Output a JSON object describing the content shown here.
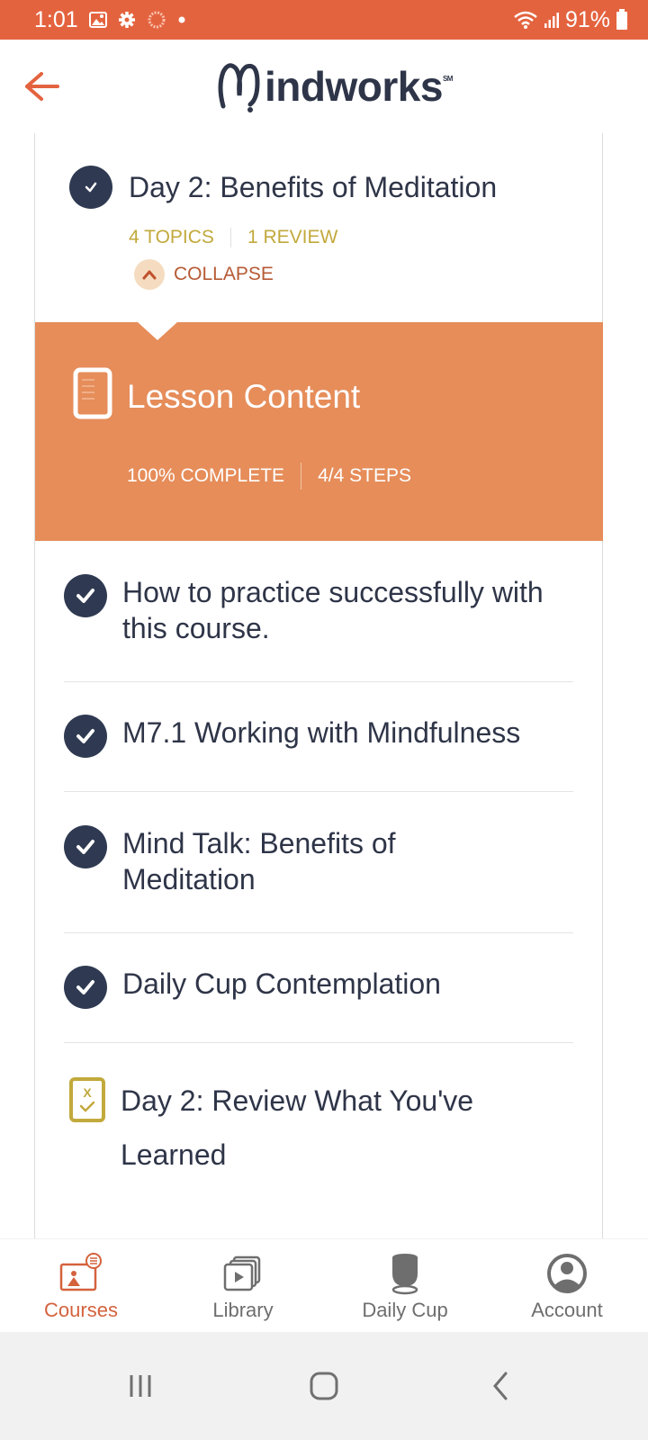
{
  "status_bar": {
    "time": "1:01",
    "battery": "91%",
    "icons": [
      "image-icon",
      "gear-icon",
      "sync-icon",
      "dot-icon",
      "wifi-icon",
      "signal-icon",
      "battery-icon"
    ]
  },
  "app_bar": {
    "back_icon": "arrow-left-icon",
    "logo_text": "indworks",
    "logo_mark": "M",
    "logo_trademark": "SM",
    "accent_color": "#e4633f"
  },
  "day": {
    "title": "Day 2: Benefits of Meditation",
    "status": "complete",
    "topics_count": "4 TOPICS",
    "review_count": "1 REVIEW",
    "collapse_label": "COLLAPSE"
  },
  "lesson_content": {
    "title": "Lesson Content",
    "progress_label": "100% COMPLETE",
    "progress_percent": 100,
    "steps_label": "4/4 STEPS",
    "color": "#e68d5a"
  },
  "topics": [
    {
      "title": "How to practice successfully with this course.",
      "status": "complete",
      "icon": "check-circle-icon"
    },
    {
      "title": "M7.1 Working with Mindfulness",
      "status": "complete",
      "icon": "check-circle-icon"
    },
    {
      "title": "Mind Talk: Benefits of Meditation",
      "status": "complete",
      "icon": "check-circle-icon"
    },
    {
      "title": "Daily Cup Contemplation",
      "status": "complete",
      "icon": "check-circle-icon"
    },
    {
      "title": "Day 2: Review What You've Learned",
      "status": "quiz",
      "icon": "quiz-icon"
    }
  ],
  "tab_bar": {
    "active": "Courses",
    "tabs": [
      {
        "label": "Courses",
        "icon": "courses-icon"
      },
      {
        "label": "Library",
        "icon": "library-icon"
      },
      {
        "label": "Daily Cup",
        "icon": "cup-icon"
      },
      {
        "label": "Account",
        "icon": "account-icon"
      }
    ]
  },
  "system_nav": {
    "buttons": [
      "recents-icon",
      "home-icon",
      "back-icon"
    ]
  }
}
